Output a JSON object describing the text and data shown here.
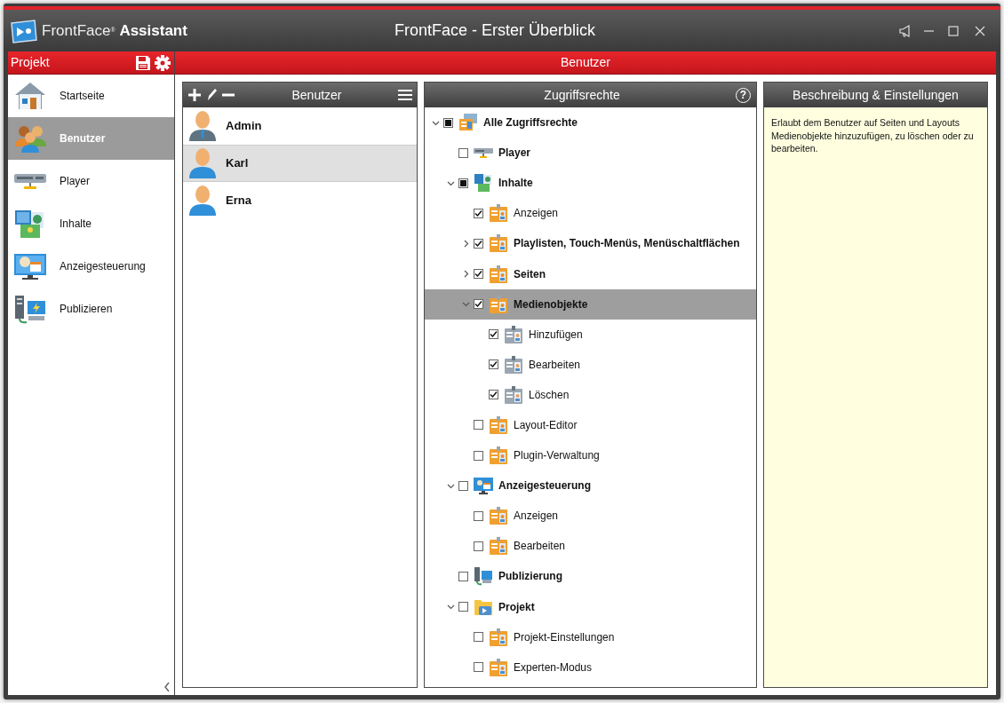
{
  "window": {
    "app_name": "FrontFace$^{®}$ **Assistant**",
    "title": "FrontFace - Erster Überblick"
  },
  "sidebar": {
    "title": "Projekt",
    "items": [
      {
        "label": "Startseite",
        "kind": "home",
        "selected": false
      },
      {
        "label": "Benutzer",
        "kind": "users",
        "selected": true
      },
      {
        "label": "Player",
        "kind": "player",
        "selected": false
      },
      {
        "label": "Inhalte",
        "kind": "content",
        "selected": false
      },
      {
        "label": "Anzeigesteuerung",
        "kind": "display",
        "selected": false
      },
      {
        "label": "Publizieren",
        "kind": "publish",
        "selected": false
      }
    ]
  },
  "page": {
    "title": "Benutzer"
  },
  "users": {
    "title": "Benutzer",
    "items": [
      {
        "name": "Admin",
        "kind": "admin",
        "selected": false
      },
      {
        "name": "Karl",
        "kind": "user",
        "selected": true
      },
      {
        "name": "Erna",
        "kind": "user",
        "selected": false
      }
    ]
  },
  "permissions": {
    "title": "Zugriffsrechte",
    "help": "?",
    "items": [
      {
        "label": "Alle Zugriffsrechte",
        "kind": "all",
        "bold": true,
        "checked": false,
        "indeterminate": true,
        "selected": false,
        "expanded": true,
        "children": [
          {
            "label": "Player",
            "kind": "player",
            "bold": true,
            "checked": false,
            "indeterminate": false,
            "selected": false
          },
          {
            "label": "Inhalte",
            "kind": "content",
            "bold": true,
            "checked": false,
            "indeterminate": true,
            "selected": false,
            "expanded": true,
            "children": [
              {
                "label": "Anzeigen",
                "kind": "permission",
                "bold": false,
                "checked": true,
                "indeterminate": false,
                "selected": false
              },
              {
                "label": "Playlisten, Touch-Menüs, Menüschaltflächen",
                "kind": "permission",
                "bold": true,
                "checked": true,
                "indeterminate": false,
                "selected": false,
                "expanded": false
              },
              {
                "label": "Seiten",
                "kind": "permission",
                "bold": true,
                "checked": true,
                "indeterminate": false,
                "selected": false,
                "expanded": false
              },
              {
                "label": "Medienobjekte",
                "kind": "permission",
                "bold": true,
                "checked": true,
                "indeterminate": false,
                "selected": true,
                "expanded": true,
                "children": [
                  {
                    "label": "Hinzufügen",
                    "kind": "permission-grey",
                    "bold": false,
                    "checked": true,
                    "indeterminate": false,
                    "selected": false
                  },
                  {
                    "label": "Bearbeiten",
                    "kind": "permission-grey",
                    "bold": false,
                    "checked": true,
                    "indeterminate": false,
                    "selected": false
                  },
                  {
                    "label": "Löschen",
                    "kind": "permission-grey",
                    "bold": false,
                    "checked": true,
                    "indeterminate": false,
                    "selected": false
                  }
                ]
              },
              {
                "label": "Layout-Editor",
                "kind": "permission",
                "bold": false,
                "checked": false,
                "indeterminate": false,
                "selected": false
              },
              {
                "label": "Plugin-Verwaltung",
                "kind": "permission",
                "bold": false,
                "checked": false,
                "indeterminate": false,
                "selected": false
              }
            ]
          },
          {
            "label": "Anzeigesteuerung",
            "kind": "display",
            "bold": true,
            "checked": false,
            "indeterminate": false,
            "selected": false,
            "expanded": true,
            "children": [
              {
                "label": "Anzeigen",
                "kind": "permission",
                "bold": false,
                "checked": false,
                "indeterminate": false,
                "selected": false
              },
              {
                "label": "Bearbeiten",
                "kind": "permission",
                "bold": false,
                "checked": false,
                "indeterminate": false,
                "selected": false
              }
            ]
          },
          {
            "label": "Publizierung",
            "kind": "publish",
            "bold": true,
            "checked": false,
            "indeterminate": false,
            "selected": false
          },
          {
            "label": "Projekt",
            "kind": "project",
            "bold": true,
            "checked": false,
            "indeterminate": false,
            "selected": false,
            "expanded": true,
            "children": [
              {
                "label": "Projekt-Einstellungen",
                "kind": "permission",
                "bold": false,
                "checked": false,
                "indeterminate": false,
                "selected": false
              },
              {
                "label": "Experten-Modus",
                "kind": "permission",
                "bold": false,
                "checked": false,
                "indeterminate": false,
                "selected": false
              }
            ]
          }
        ]
      }
    ]
  },
  "details": {
    "title": "Beschreibung & Einstellungen",
    "text": "Erlaubt dem Benutzer auf Seiten und Layouts Medienobjekte hinzuzufügen, zu löschen oder zu bearbeiten."
  }
}
